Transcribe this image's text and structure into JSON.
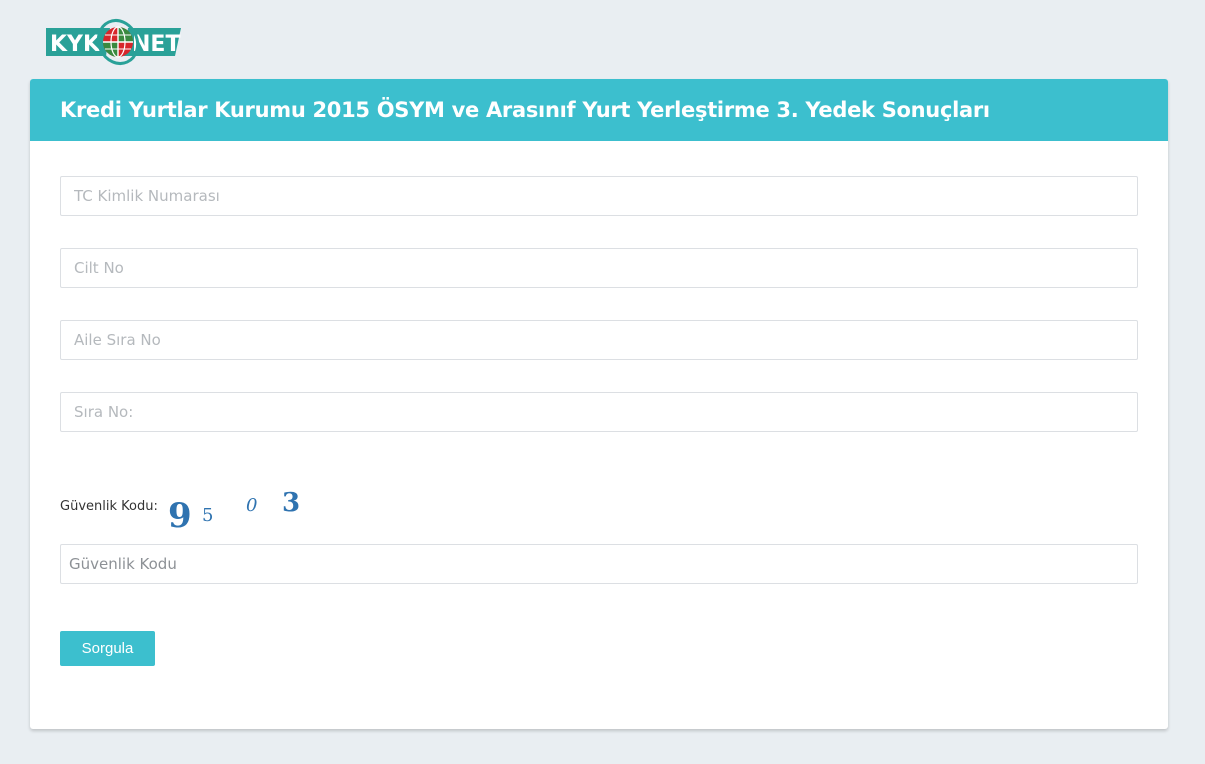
{
  "logo": {
    "left_text": "KYK",
    "right_text": "NET",
    "colors": {
      "badge": "#2aa198",
      "globe_red": "#d7262b",
      "globe_green": "#3a8a3f"
    }
  },
  "page": {
    "title": "Kredi Yurtlar Kurumu 2015 ÖSYM ve Arasınıf Yurt Yerleştirme 3. Yedek Sonuçları"
  },
  "form": {
    "tc_placeholder": "TC Kimlik Numarası",
    "cilt_placeholder": "Cilt No",
    "aile_placeholder": "Aile Sıra No",
    "sira_placeholder": "Sıra No:",
    "captcha_label": "Güvenlik Kodu:",
    "captcha_chars": [
      "9",
      "5",
      "0",
      "3"
    ],
    "captcha_placeholder": "Güvenlik Kodu",
    "submit_label": "Sorgula"
  },
  "colors": {
    "accent": "#3cbfce",
    "background": "#e9eef2",
    "captcha_ink": "#2f73b0"
  }
}
